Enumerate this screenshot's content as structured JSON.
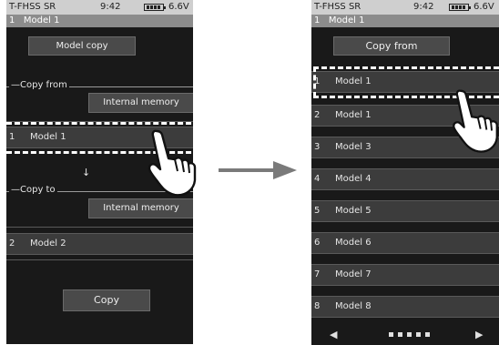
{
  "left": {
    "status_title": "T-FHSS SR",
    "time": "9:42",
    "voltage": "6.6V",
    "model_header": "1   Model 1",
    "model_copy_label": "Model copy",
    "copy_from_label": "Copy from",
    "internal_memory_from": "Internal memory",
    "from_model_num": "1",
    "from_model_name": "Model 1",
    "down_arrow": "↓",
    "copy_to_label": "Copy to",
    "internal_memory_to": "Internal memory",
    "to_model_num": "2",
    "to_model_name": "Model 2",
    "copy_button": "Copy"
  },
  "right": {
    "status_title": "T-FHSS SR",
    "time": "9:42",
    "voltage": "6.6V",
    "model_header": "1   Model 1",
    "copy_from_label": "Copy from",
    "models": [
      {
        "num": "1",
        "name": "Model 1"
      },
      {
        "num": "2",
        "name": "Model 1"
      },
      {
        "num": "3",
        "name": "Model 3"
      },
      {
        "num": "4",
        "name": "Model 4"
      },
      {
        "num": "5",
        "name": "Model 5"
      },
      {
        "num": "6",
        "name": "Model 6"
      },
      {
        "num": "7",
        "name": "Model 7"
      },
      {
        "num": "8",
        "name": "Model 8"
      }
    ],
    "prev_arrow": "◀",
    "next_arrow": "▶"
  },
  "colors": {
    "screen_bg": "#191919",
    "status_bar": "#cfcfcf",
    "model_bar": "#8c8c8c",
    "row_bg": "#3c3c3c",
    "button_bg": "#4a4a4a",
    "arrow": "#7a7a7a"
  }
}
